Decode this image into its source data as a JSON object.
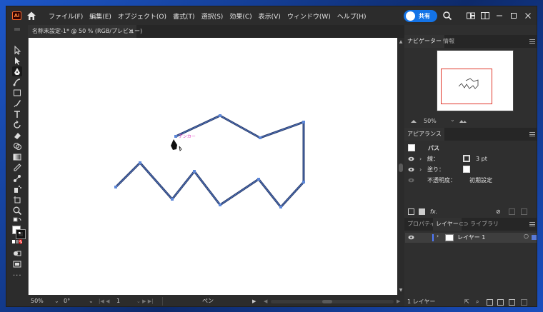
{
  "app": {
    "logo_text": "Ai",
    "accent": "#1473e6",
    "path_color": "#2a3d6e",
    "selection_color": "#e0362a"
  },
  "menu": {
    "items": [
      "ファイル(F)",
      "編集(E)",
      "オブジェクト(O)",
      "書式(T)",
      "選択(S)",
      "効果(C)",
      "表示(V)",
      "ウィンドウ(W)",
      "ヘルプ(H)"
    ]
  },
  "share": {
    "label": "共有"
  },
  "document": {
    "tab_title": "名称未設定-1* @ 50 % (RGB/プレビュー)",
    "close": "×"
  },
  "status": {
    "zoom": "50%",
    "rotation": "0°",
    "artboard": "1",
    "tool": "ペン"
  },
  "panels": {
    "navigator": {
      "tabs": [
        "ナビゲーター",
        "情報"
      ],
      "zoom": "50%"
    },
    "appearance": {
      "tab": "アピアランス",
      "object": "パス",
      "stroke_label": "線：",
      "stroke_value": "3 pt",
      "fill_label": "塗り：",
      "opacity_label": "不透明度：",
      "opacity_value": "初期設定",
      "fx": "fx."
    },
    "layers": {
      "tabs": [
        "プロパティ",
        "レイヤー",
        "ライブラリ"
      ],
      "layer_name": "レイヤー 1",
      "count": "1 レイヤー"
    }
  },
  "icons": [
    "home-icon",
    "search-icon",
    "arrange-icon",
    "minimize-icon",
    "maximize-icon",
    "close-icon",
    "selection-tool-icon",
    "direct-selection-tool-icon",
    "pen-tool-icon",
    "eye-icon"
  ]
}
